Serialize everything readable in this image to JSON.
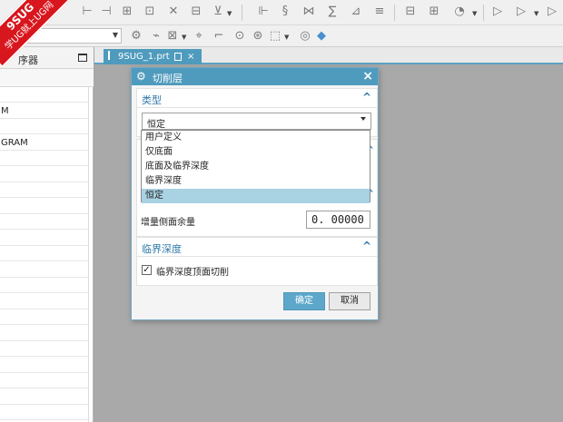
{
  "ribbon": {
    "brand": "9SUG",
    "slogan": "学UG就上UG网"
  },
  "navigator": {
    "title": "序列导航器",
    "title_visible": "序器"
  },
  "nav_rows": [
    "",
    "M",
    "",
    "GRAM",
    "",
    "",
    "",
    "",
    "",
    "",
    "",
    "",
    "",
    "",
    "",
    "",
    "",
    "",
    "",
    "",
    ""
  ],
  "tab": {
    "label": "9SUG_1.prt",
    "close": "×"
  },
  "dialog": {
    "title": "切削层",
    "close": "×",
    "type_section": {
      "title": "类型",
      "caret": "^",
      "selected": "恒定"
    },
    "dropdown_options": [
      "用户定义",
      "仅底面",
      "底面及临界深度",
      "临界深度",
      "恒定"
    ],
    "increment_label": "增量侧面余量",
    "increment_value": "0. 00000",
    "critical_section": {
      "title": "临界深度",
      "caret": "^"
    },
    "checkbox_label": "临界深度顶面切削",
    "checkbox_checked": true,
    "ok_label": "确定",
    "cancel_label": "取消"
  },
  "colors": {
    "accent": "#4f9bbd",
    "ribbon": "#d8161d",
    "selected": "#a9d2e3"
  }
}
